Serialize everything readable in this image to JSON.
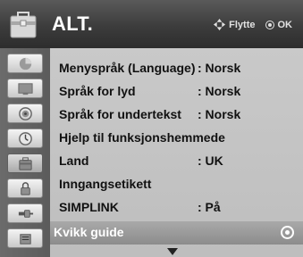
{
  "header": {
    "title": "ALT.",
    "move_hint": "Flytte",
    "ok_hint": "OK"
  },
  "sidebar": {
    "icons": [
      "picture-icon",
      "screen-icon",
      "audio-icon",
      "clock-icon",
      "options-icon",
      "lock-icon",
      "input-icon",
      "usb-icon"
    ],
    "active_index": 4
  },
  "menu": {
    "items": [
      {
        "label": "Menyspråk (Language)",
        "value": ": Norsk"
      },
      {
        "label": "Språk for lyd",
        "value": ": Norsk"
      },
      {
        "label": "Språk for undertekst",
        "value": ": Norsk"
      },
      {
        "label": "Hjelp til funksjonshemmede",
        "value": ""
      },
      {
        "label": "Land",
        "value": ": UK"
      },
      {
        "label": "Inngangsetikett",
        "value": ""
      },
      {
        "label": "SIMPLINK",
        "value": ": På"
      },
      {
        "label": "Kvikk guide",
        "value": ""
      }
    ],
    "selected_index": 7,
    "more_below": true
  },
  "colors": {
    "header_bg": "#3c3c3c",
    "panel_bg": "#c4c4c4",
    "sidebar_bg": "#626262",
    "selected_row_bg": "#9a9a9a"
  }
}
